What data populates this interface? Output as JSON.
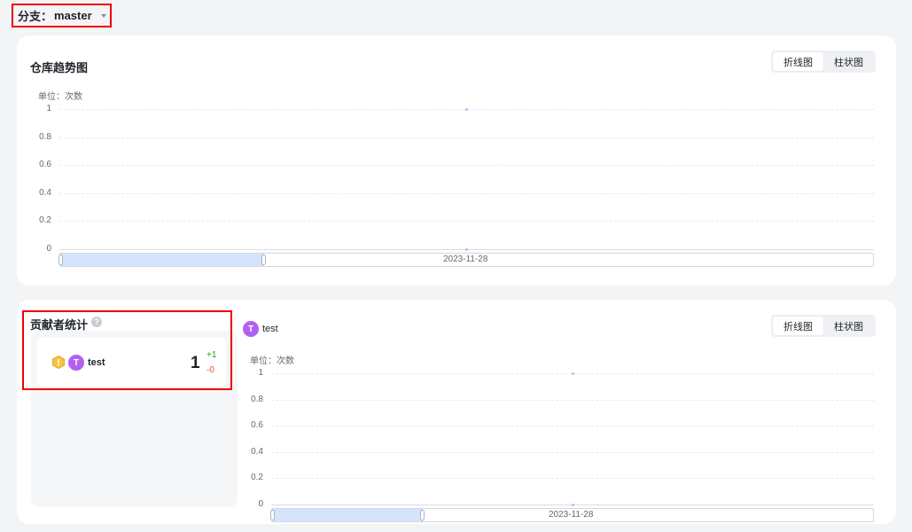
{
  "branch": {
    "label": "分支：",
    "value": "master"
  },
  "repo_trend": {
    "title": "仓库趋势图",
    "tabs": [
      {
        "label": "折线图",
        "active": true
      },
      {
        "label": "柱状图",
        "active": false
      }
    ],
    "unit": "单位：次数",
    "y_ticks": [
      "1",
      "0.8",
      "0.6",
      "0.4",
      "0.2",
      "0"
    ],
    "x_label": "2023-11-28",
    "zoom_range": [
      0,
      0.25
    ]
  },
  "contributors": {
    "title": "贡献者统计",
    "help_icon": "question-circle-icon",
    "list": [
      {
        "initial": "T",
        "name": "test",
        "count": "1",
        "additions": "+1",
        "deletions": "-0",
        "rank_badge": "gold-medal-icon"
      }
    ],
    "selected": {
      "initial": "T",
      "name": "test"
    },
    "tabs": [
      {
        "label": "折线图",
        "active": true
      },
      {
        "label": "柱状图",
        "active": false
      }
    ],
    "unit": "单位：次数",
    "y_ticks": [
      "1",
      "0.8",
      "0.6",
      "0.4",
      "0.2",
      "0"
    ],
    "x_label": "2023-11-28",
    "zoom_range": [
      0,
      0.25
    ]
  },
  "chart_data": [
    {
      "type": "line",
      "title": "仓库趋势图",
      "ylabel": "单位：次数",
      "x": [
        "2023-11-28"
      ],
      "series": [
        {
          "values": [
            1
          ]
        }
      ],
      "ylim": [
        0,
        1
      ],
      "grid": true
    },
    {
      "type": "line",
      "title": "",
      "ylabel": "单位：次数",
      "x": [
        "2023-11-28"
      ],
      "series": [
        {
          "name": "test",
          "values": [
            1
          ]
        }
      ],
      "ylim": [
        0,
        1
      ],
      "grid": true
    }
  ],
  "colors": {
    "accent": "#b260f2",
    "positive": "#2ea121",
    "negative": "#f54a45",
    "highlight_box": "#ee0000"
  }
}
